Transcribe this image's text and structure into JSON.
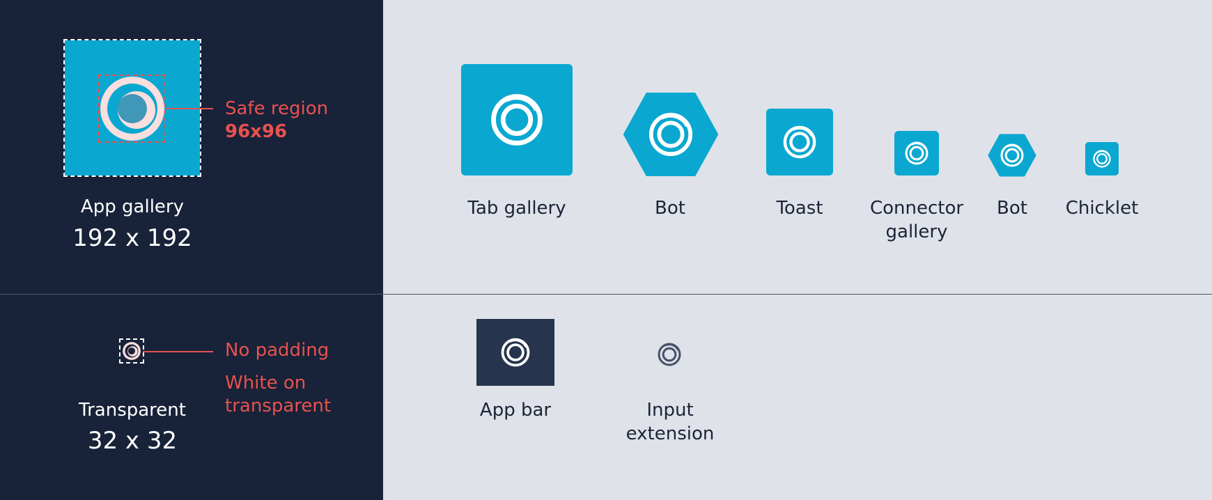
{
  "colors": {
    "dark_panel": "#182239",
    "light_panel": "#dfe2e8",
    "teal": "#0aa8d0",
    "accent_red": "#e8524f",
    "app_bar_bg": "#27344d"
  },
  "hero": {
    "label": "App gallery",
    "size": "192 x 192",
    "safe_region_label": "Safe region",
    "safe_region_size": "96x96"
  },
  "transparent": {
    "label": "Transparent",
    "size": "32 x 32",
    "no_padding": "No padding",
    "white_on": "White on",
    "transparent_word": "transparent"
  },
  "variants": [
    {
      "label": "Tab gallery",
      "icon": "logo-icon"
    },
    {
      "label": "Bot",
      "icon": "logo-icon"
    },
    {
      "label": "Toast",
      "icon": "logo-icon"
    },
    {
      "label_line1": "Connector",
      "label_line2": "gallery",
      "icon": "logo-icon"
    },
    {
      "label": "Bot",
      "icon": "logo-icon"
    },
    {
      "label": "Chicklet",
      "icon": "logo-icon"
    }
  ],
  "bottom_variants": [
    {
      "label": "App bar",
      "icon": "logo-icon"
    },
    {
      "label_line1": "Input",
      "label_line2": "extension",
      "icon": "logo-icon"
    }
  ]
}
